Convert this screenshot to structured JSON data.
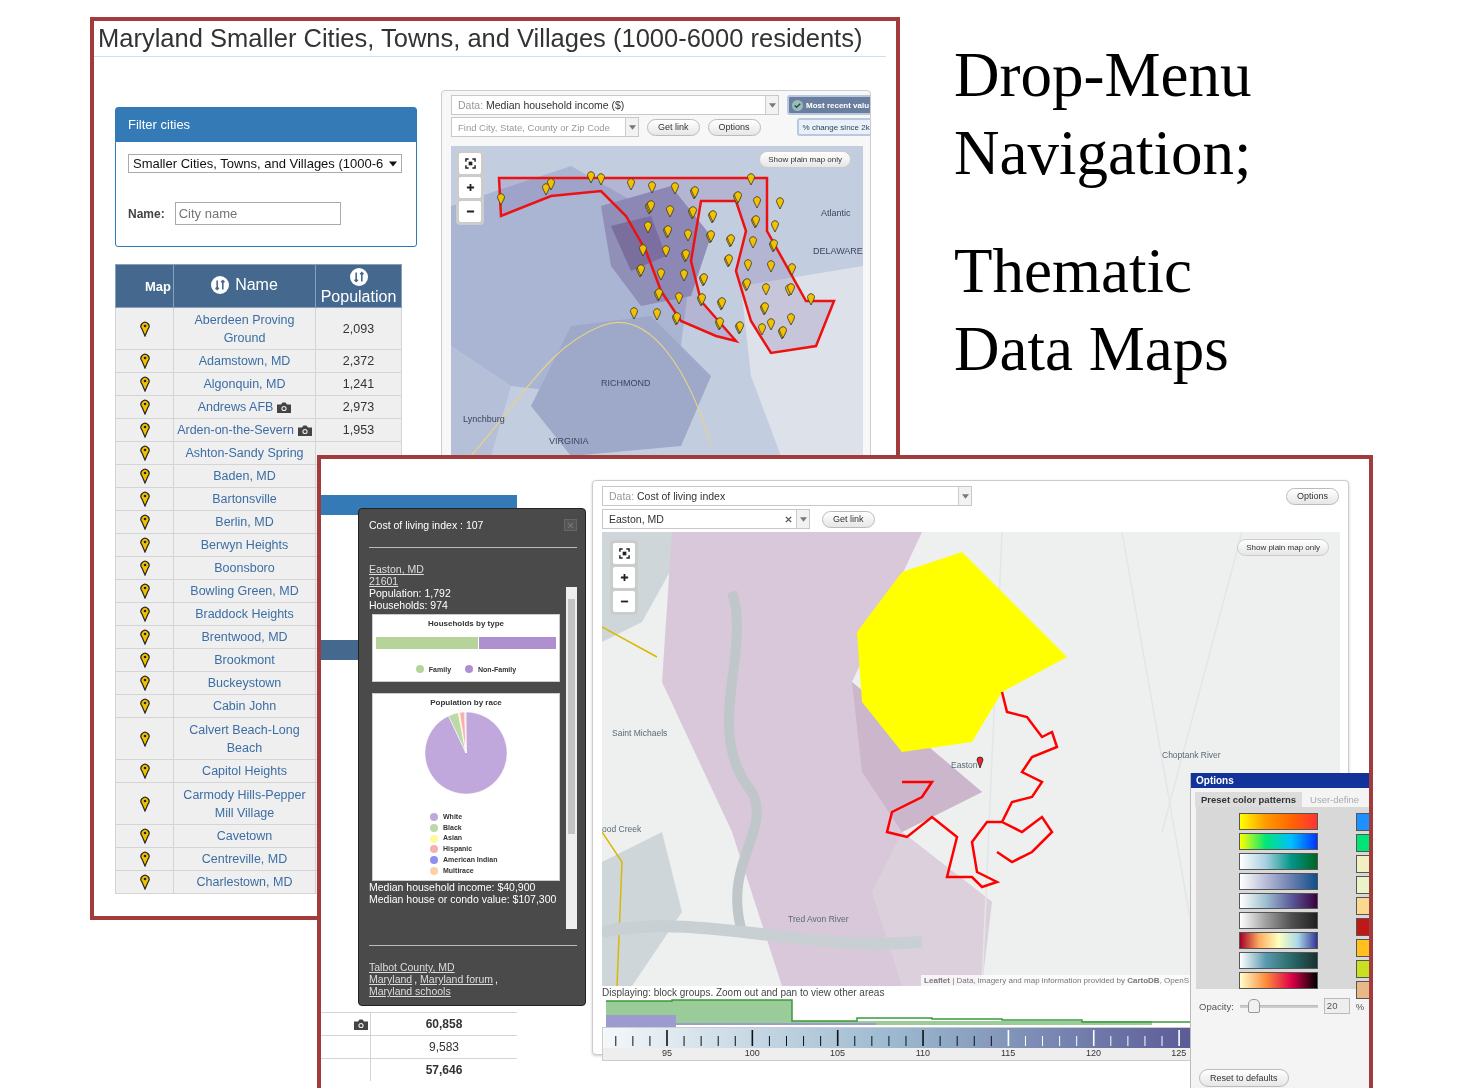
{
  "slide_text": {
    "heading_lines": [
      "Drop-Menu",
      "Navigation;"
    ],
    "subheading_lines": [
      "Thematic",
      "Data Maps"
    ]
  },
  "back_window": {
    "title": "Maryland Smaller Cities, Towns, and Villages (1000-6000 residents)",
    "filter": {
      "header": "Filter cities",
      "category": "Smaller Cities, Towns, and Villages (1000-6",
      "name_label": "Name:",
      "name_placeholder": "City name"
    },
    "table": {
      "columns": [
        "Map",
        "Name",
        "Population"
      ],
      "rows": [
        {
          "name": "Aberdeen Proving Ground",
          "population": "2,093",
          "has_photo": false
        },
        {
          "name": "Adamstown, MD",
          "population": "2,372",
          "has_photo": false
        },
        {
          "name": "Algonquin, MD",
          "population": "1,241",
          "has_photo": false
        },
        {
          "name": "Andrews AFB",
          "population": "2,973",
          "has_photo": true
        },
        {
          "name": "Arden-on-the-Severn",
          "population": "1,953",
          "has_photo": true
        },
        {
          "name": "Ashton-Sandy Spring",
          "has_photo": false
        },
        {
          "name": "Baden, MD",
          "has_photo": false
        },
        {
          "name": "Bartonsville",
          "has_photo": false
        },
        {
          "name": "Berlin, MD",
          "has_photo": false
        },
        {
          "name": "Berwyn Heights",
          "has_photo": false
        },
        {
          "name": "Boonsboro",
          "has_photo": false
        },
        {
          "name": "Bowling Green, MD",
          "has_photo": false
        },
        {
          "name": "Braddock Heights",
          "has_photo": false
        },
        {
          "name": "Brentwood, MD",
          "has_photo": false
        },
        {
          "name": "Brookmont",
          "has_photo": false
        },
        {
          "name": "Buckeystown",
          "has_photo": false
        },
        {
          "name": "Cabin John",
          "has_photo": false
        },
        {
          "name": "Calvert Beach-Long Beach",
          "has_photo": false
        },
        {
          "name": "Capitol Heights",
          "has_photo": false
        },
        {
          "name": "Carmody Hills-Pepper Mill Village",
          "has_photo": false
        },
        {
          "name": "Cavetown",
          "has_photo": false
        },
        {
          "name": "Centreville, MD",
          "has_photo": false
        },
        {
          "name": "Charlestown, MD",
          "has_photo": false
        }
      ]
    },
    "map_panel": {
      "data_label": "Data:",
      "data_value": "Median household income ($)",
      "recent_toggle": {
        "label": "Most recent valu",
        "checked": true
      },
      "change_button": "% change since 2k",
      "search_placeholder": "Find City, State, County or Zip Code",
      "get_link": "Get link",
      "options": "Options",
      "plain_map": "Show plain map only",
      "map_labels": [
        "Atlantic",
        "DELAWARE",
        "Lynchburg",
        "RICHMOND",
        "VIRGINIA"
      ]
    }
  },
  "front_window": {
    "side_table": {
      "rows": [
        {
          "value": "60,858",
          "bold": true,
          "has_photo": true
        },
        {
          "value": "9,583",
          "bold": false,
          "has_photo": false
        },
        {
          "value": "57,646",
          "bold": true,
          "has_photo": false
        }
      ]
    },
    "popup": {
      "title": "Cost of living index : 107",
      "place_link": "Easton, MD",
      "zip_link": "21601",
      "population": "Population: 1,792",
      "households": "Households: 974",
      "household_chart": {
        "title": "Households by type",
        "legend": [
          {
            "label": "Family",
            "color": "#b5d49a"
          },
          {
            "label": "Non-Family",
            "color": "#b08fd0"
          }
        ]
      },
      "race_chart": {
        "title": "Population by race",
        "legend": [
          {
            "label": "White",
            "color": "#c0a8dc"
          },
          {
            "label": "Black",
            "color": "#bcd9a8"
          },
          {
            "label": "Asian",
            "color": "#fffa9c"
          },
          {
            "label": "Hispanic",
            "color": "#f7b0b0"
          },
          {
            "label": "American Indian",
            "color": "#8f8ff0"
          },
          {
            "label": "Multirace",
            "color": "#ffd0a8"
          }
        ]
      },
      "income": "Median household income: $40,900",
      "house_value": "Median house or condo value: $107,300",
      "county_link": "Talbot County, MD",
      "links": [
        {
          "text": "Maryland",
          "sep": ","
        },
        {
          "text": "Maryland forum",
          "sep": ","
        },
        {
          "text": "Maryland schools"
        }
      ]
    },
    "map_panel": {
      "data_label": "Data:",
      "data_value": "Cost of living index",
      "location": "Easton, MD",
      "get_link": "Get link",
      "options": "Options",
      "plain_map": "Show plain map only",
      "map_labels": [
        "Saint Michaels",
        "ood Creek",
        "Easton",
        "Choptank River",
        "Tred Avon River"
      ],
      "attribution": "**Leaflet** | Data, imagery and map information provided by **CartoDB**, OpenS",
      "status": "Displaying: block groups. Zoom out and pan to view other areas",
      "scale_labels": [
        "95",
        "100",
        "105",
        "110",
        "115",
        "120",
        "125"
      ]
    },
    "options_panel": {
      "title": "Options",
      "tabs": [
        {
          "label": "Preset color patterns",
          "selected": true
        },
        {
          "label": "User-define",
          "selected": false
        }
      ],
      "opacity_label": "Opacity:",
      "opacity": {
        "level": 0.2
      },
      "opacity_value": "20",
      "opacity_unit": "%",
      "reset": "Reset to defaults"
    }
  }
}
